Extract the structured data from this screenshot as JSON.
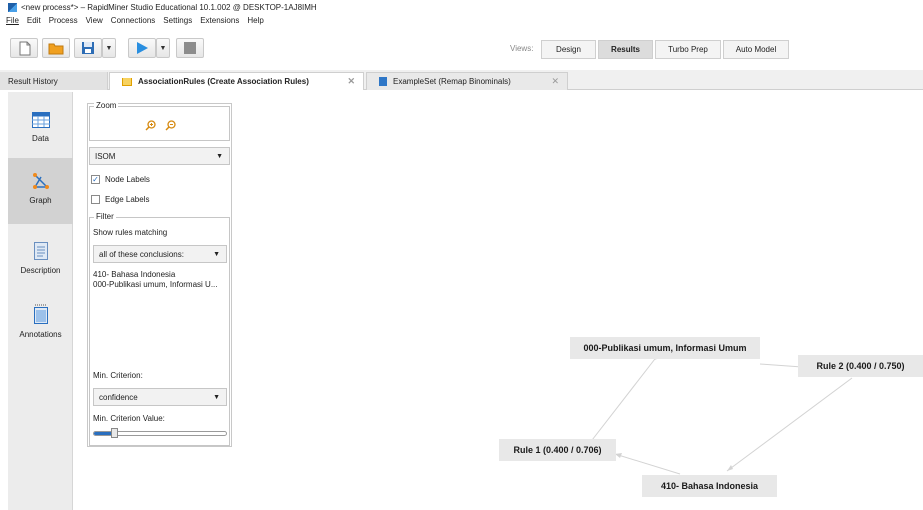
{
  "window": {
    "title": "<new process*> – RapidMiner Studio Educational 10.1.002 @ DESKTOP-1AJ8IMH"
  },
  "menu": [
    "File",
    "Edit",
    "Process",
    "View",
    "Connections",
    "Settings",
    "Extensions",
    "Help"
  ],
  "toolbar": {
    "views_label": "Views:",
    "views": [
      "Design",
      "Results",
      "Turbo Prep",
      "Auto Model"
    ],
    "active_view": "Results"
  },
  "tabs": {
    "history": "Result History",
    "assoc": "AssociationRules (Create Association Rules)",
    "example": "ExampleSet (Remap Binominals)"
  },
  "sidebar": {
    "items": [
      {
        "label": "Data",
        "icon": "table-icon"
      },
      {
        "label": "Graph",
        "icon": "graph-icon"
      },
      {
        "label": "Description",
        "icon": "document-icon"
      },
      {
        "label": "Annotations",
        "icon": "notes-icon"
      }
    ],
    "active": "Graph"
  },
  "panel": {
    "zoom_legend": "Zoom",
    "layout_value": "ISOM",
    "node_labels": "Node Labels",
    "node_labels_checked": true,
    "edge_labels": "Edge Labels",
    "edge_labels_checked": false,
    "filter_legend": "Filter",
    "show_rules": "Show rules matching",
    "match_mode": "all of these conclusions:",
    "conclusions": [
      "410- Bahasa Indonesia",
      "000-Publikasi umum, Informasi U..."
    ],
    "min_criterion_label": "Min. Criterion:",
    "min_criterion_value": "confidence",
    "min_criterion_value_label": "Min. Criterion Value:",
    "min_criterion_slider": 0.15
  },
  "graph": {
    "nodes": {
      "publikasi": "000-Publikasi umum, Informasi Umum",
      "rule2": "Rule 2 (0.400 / 0.750)",
      "rule1": "Rule 1 (0.400 / 0.706)",
      "bahasa": "410- Bahasa Indonesia"
    }
  },
  "colors": {
    "accent": "#2a6fbf",
    "run_button": "#2a8fe0",
    "save_button": "#2d6db5",
    "folder": "#f0a020"
  }
}
